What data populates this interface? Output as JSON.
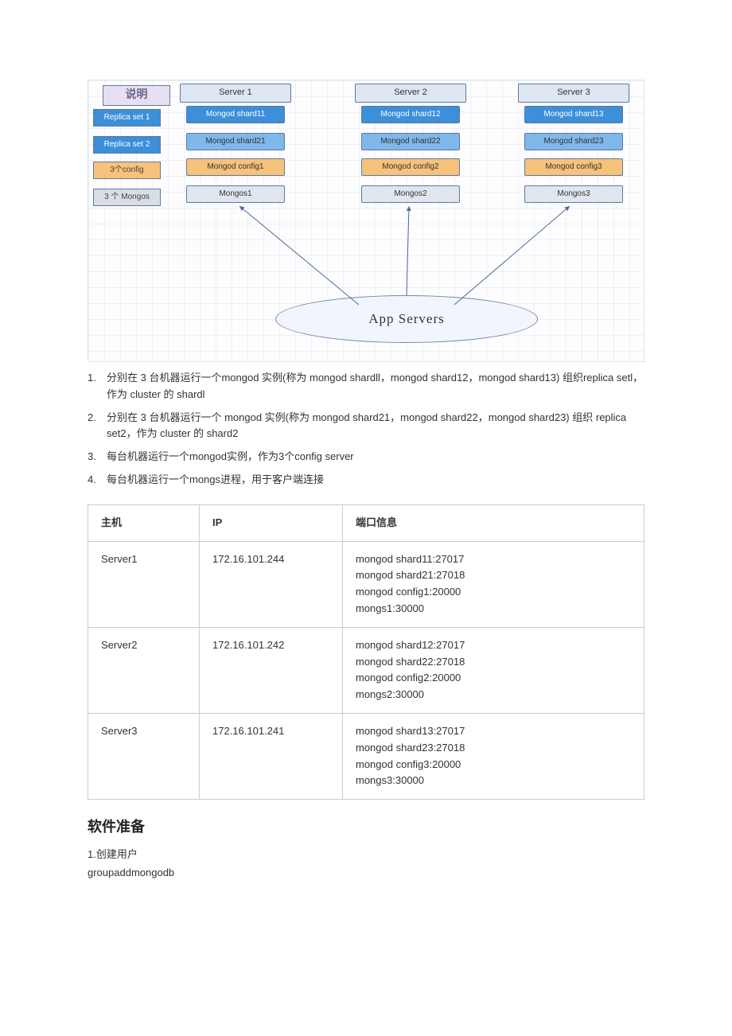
{
  "diagram": {
    "legend": "说明",
    "row_labels": [
      "Replica set 1",
      "Replica set 2",
      "3个config",
      "3 个 Mongos"
    ],
    "col_headers": [
      "Server 1",
      "Server 2",
      "Server 3"
    ],
    "cells": {
      "r1": [
        "Mongod shard11",
        "Mongod shard12",
        "Mongod shard13"
      ],
      "r2": [
        "Mongod shard21",
        "Mongod shard22",
        "Mongod shard23"
      ],
      "r3": [
        "Mongod config1",
        "Mongod config2",
        "Mongod config3"
      ],
      "r4": [
        "Mongos1",
        "Mongos2",
        "Mongos3"
      ]
    },
    "app": "App    Servers"
  },
  "steps": [
    "分别在 3 台机器运行一个mongod 实例(称为 mongod shardll，mongod shard12，mongod shard13) 组织replica setl，作为 cluster 的 shardl",
    "分别在 3 台机器运行一个 mongod 实例(称为 mongod shard21，mongod shard22，mongod shard23) 组织 replica set2，作为 cluster 的 shard2",
    "每台机器运行一个mongod实例，作为3个config server",
    "每台机器运行一个mongs进程，用于客户端连接"
  ],
  "table": {
    "headers": [
      "主机",
      "IP",
      "端口信息"
    ],
    "rows": [
      {
        "host": "Server1",
        "ip": "172.16.101.244",
        "ports": [
          "mongod shard11:27017",
          "mongod shard21:27018",
          "mongod config1:20000",
          "mongs1:30000"
        ]
      },
      {
        "host": "Server2",
        "ip": "172.16.101.242",
        "ports": [
          "mongod shard12:27017",
          "mongod shard22:27018",
          "mongod config2:20000",
          "mongs2:30000"
        ]
      },
      {
        "host": "Server3",
        "ip": "172.16.101.241",
        "ports": [
          "mongod shard13:27017",
          "mongod shard23:27018",
          "mongod config3:20000",
          "mongs3:30000"
        ]
      }
    ]
  },
  "section_title": "软件准备",
  "plain": [
    "1.创建用户",
    "groupaddmongodb"
  ]
}
